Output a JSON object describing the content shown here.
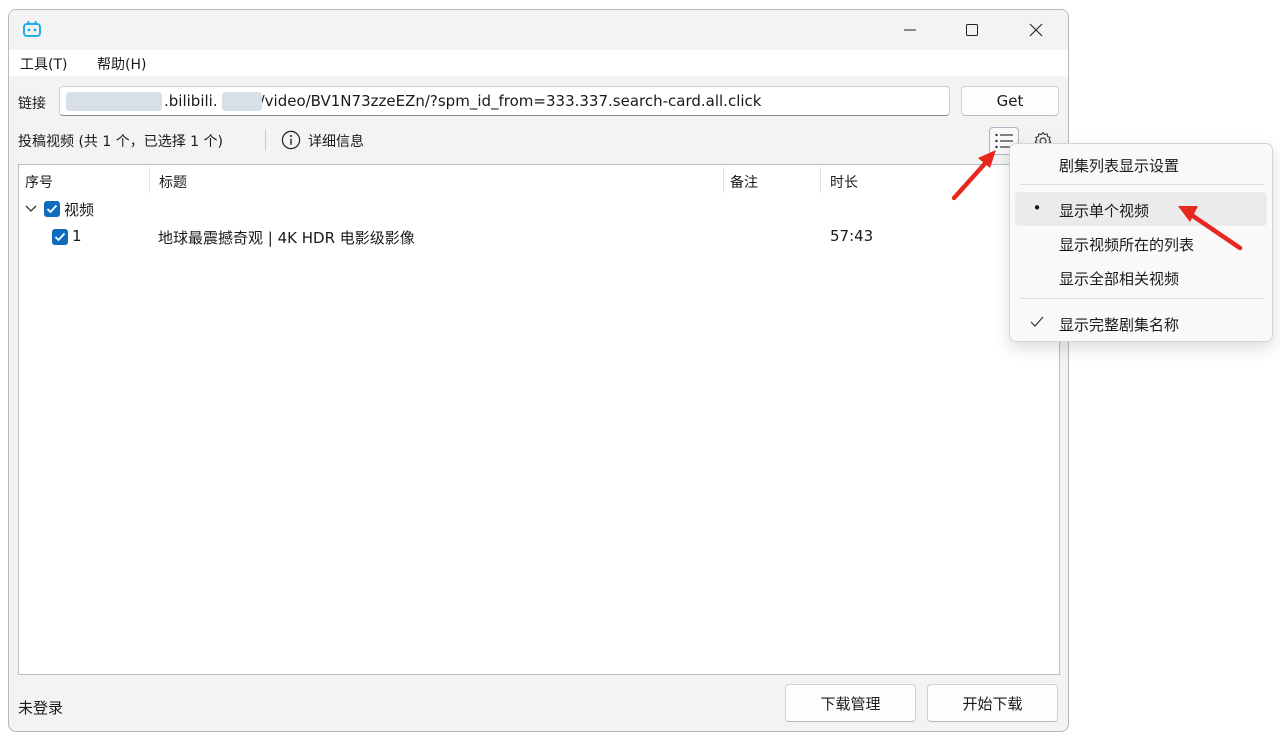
{
  "window": {
    "app_icon": "bilibili-tv-icon",
    "controls": {
      "minimize": "minimize-icon",
      "maximize": "maximize-icon",
      "close": "close-icon"
    }
  },
  "menubar": {
    "items": [
      {
        "label": "工具(T)"
      },
      {
        "label": "帮助(H)"
      }
    ]
  },
  "url_bar": {
    "label": "链接",
    "value_parts": [
      ".bilibili.",
      "/video/BV1N73zzeEZn/?spm_id_from=333.337.search-card.all.click"
    ],
    "get_label": "Get"
  },
  "info_bar": {
    "summary": "投稿视频 (共 1 个，已选择 1 个)",
    "detail_label": "详细信息",
    "icons": {
      "info": "info-icon",
      "list": "list-icon",
      "settings": "gear-icon"
    }
  },
  "table": {
    "headers": [
      "序号",
      "标题",
      "备注",
      "时长"
    ],
    "group": {
      "label": "视频",
      "checked": true,
      "expanded": true
    },
    "rows": [
      {
        "index": "1",
        "title": "地球最震撼奇观 | 4K HDR 电影级影像",
        "note": "",
        "duration": "57:43",
        "checked": true
      }
    ]
  },
  "status": {
    "login_text": "未登录"
  },
  "buttons": {
    "download_manager": "下载管理",
    "start_download": "开始下载"
  },
  "dropdown": {
    "header": "剧集列表显示设置",
    "options": [
      {
        "label": "显示单个视频",
        "selected": true
      },
      {
        "label": "显示视频所在的列表",
        "selected": false
      },
      {
        "label": "显示全部相关视频",
        "selected": false
      }
    ],
    "toggle": {
      "label": "显示完整剧集名称",
      "checked": true
    }
  },
  "colors": {
    "accent": "#0f6cbd",
    "annotation_arrow": "#e8271f",
    "app_icon": "#23ade5"
  }
}
